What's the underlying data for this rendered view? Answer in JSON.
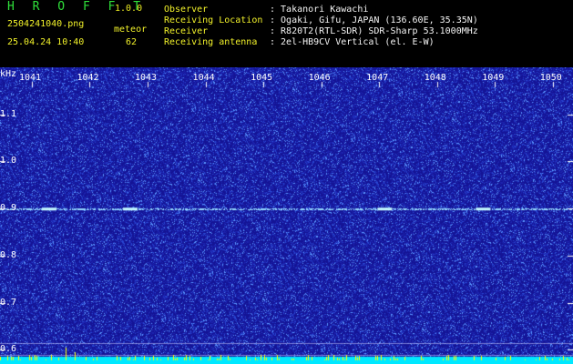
{
  "header": {
    "brand": "H R O F F T",
    "version": "1.0.0",
    "filename": "2504241040.png",
    "datetime": "25.04.24 10:40",
    "meteor_label": "meteor",
    "meteor_count": "62",
    "fields": [
      {
        "label": "Observer",
        "value": ": Takanori Kawachi"
      },
      {
        "label": "Receiving Location",
        "value": ": Ogaki, Gifu, JAPAN (136.60E, 35.35N)"
      },
      {
        "label": "Receiver",
        "value": ": R820T2(RTL-SDR) SDR-Sharp 53.1000MHz"
      },
      {
        "label": "Receiving antenna",
        "value": ": 2el-HB9CV Vertical (el. E-W)"
      }
    ]
  },
  "chart_data": {
    "type": "heatmap",
    "ylabel": "kHz",
    "yticks": [
      "1.1",
      "1.0",
      "0.9",
      "0.8",
      "0.7",
      "0.6"
    ],
    "ytick_values": [
      1.1,
      1.0,
      0.9,
      0.8,
      0.7,
      0.6
    ],
    "xticks": [
      "1041",
      "1042",
      "1043",
      "1044",
      "1045",
      "1046",
      "1047",
      "1048",
      "1049",
      "1050"
    ],
    "xtick_values": [
      1041,
      1042,
      1043,
      1044,
      1045,
      1046,
      1047,
      1048,
      1049,
      1050
    ],
    "xlim": [
      1040.45,
      1050.35
    ],
    "ylim": [
      0.57,
      1.2
    ],
    "colors": {
      "background": "#1a1aa8",
      "noise_light": "#5fa0ff",
      "signal": "#c8ffff",
      "baseline": "#00e8ff",
      "meteor_peaks": "#ffff00",
      "tick": "#ffffff"
    }
  }
}
